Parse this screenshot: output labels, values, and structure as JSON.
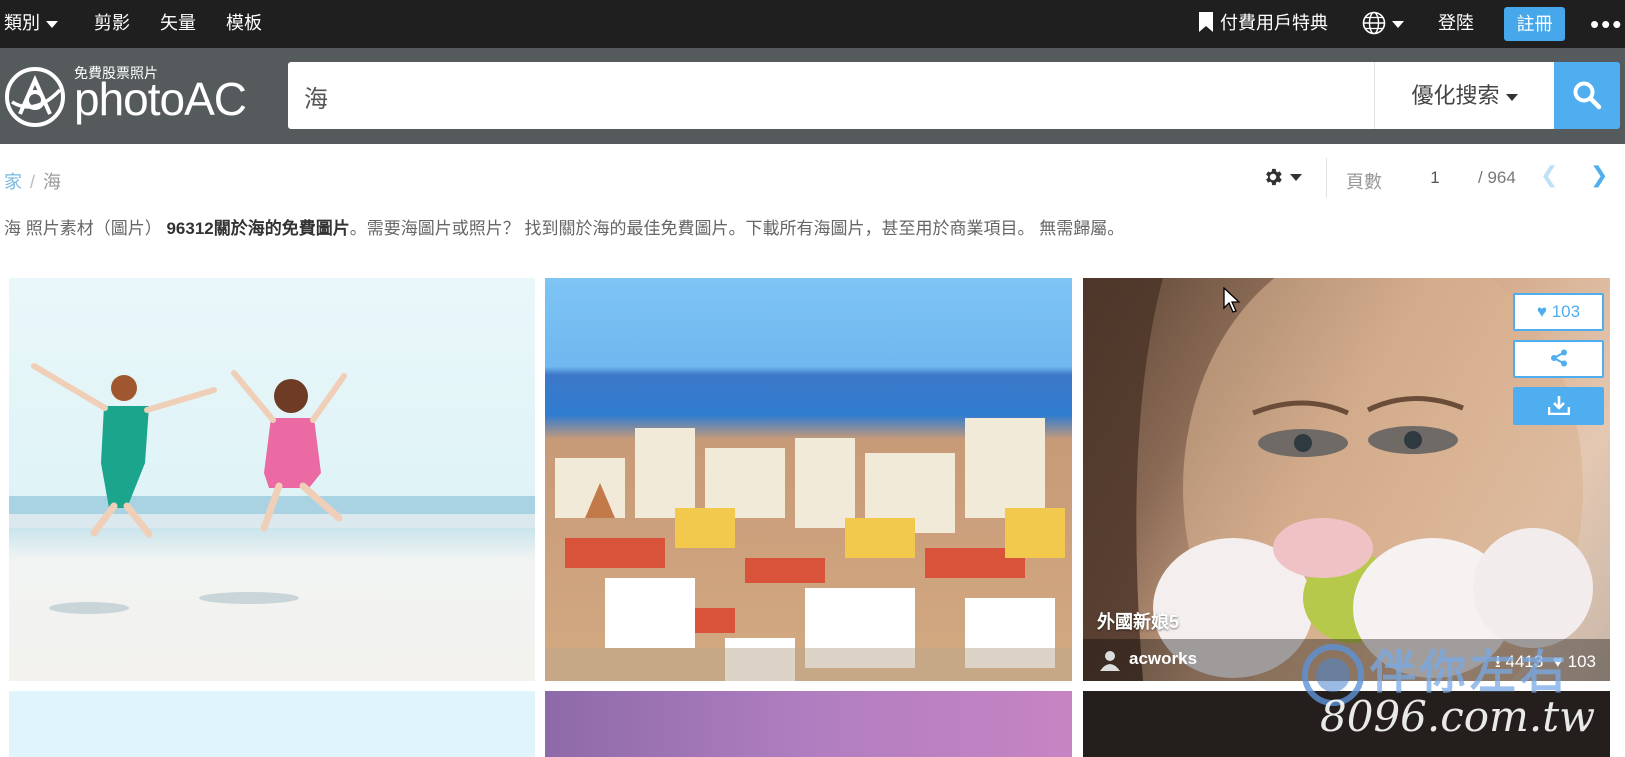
{
  "topnav": {
    "category": "類別",
    "clip": "剪影",
    "vector": "矢量",
    "template": "模板",
    "premium": "付費用戶特典",
    "login": "登陸",
    "register": "註冊"
  },
  "logo": {
    "tagline": "免費股票照片",
    "brand": "photoAC"
  },
  "search": {
    "value": "海",
    "refine": "優化搜索"
  },
  "breadcrumb": {
    "home": "家",
    "current": "海"
  },
  "pager": {
    "label": "頁數",
    "page": "1",
    "total": "/ 964"
  },
  "description": {
    "part1": "海 照片素材（圖片）",
    "count": "96312關於海的免費圖片",
    "part2": "。需要海圖片或照片？ 找到關於海的最佳免費圖片。下載所有海圖片，甚至用於商業項目。 無需歸屬。"
  },
  "featured_photo": {
    "title": "外國新娘5",
    "author": "acworks",
    "downloads": "4413",
    "likes": "103",
    "like_button": "103"
  },
  "watermark": {
    "text": "伴你左右",
    "url": "8096.com.tw"
  },
  "colors": {
    "accent": "#4eaef0",
    "topbar": "#1f1f1f",
    "header": "#555b5d"
  }
}
